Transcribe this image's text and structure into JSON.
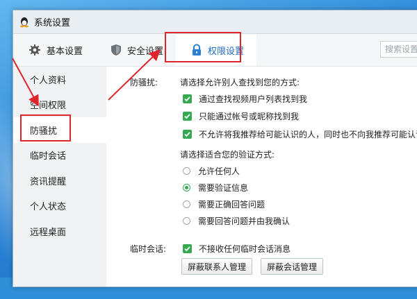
{
  "window": {
    "title": "系统设置"
  },
  "toolbar": {
    "tabs": [
      {
        "label": "基本设置",
        "icon": "gear-icon"
      },
      {
        "label": "安全设置",
        "icon": "shield-icon"
      },
      {
        "label": "权限设置",
        "icon": "lock-icon",
        "active": true
      }
    ],
    "search_placeholder": "搜索设置"
  },
  "sidebar": {
    "items": [
      {
        "label": "个人资料"
      },
      {
        "label": "空间权限"
      },
      {
        "label": "防骚扰",
        "active": true
      },
      {
        "label": "临时会话"
      },
      {
        "label": "资讯提醒"
      },
      {
        "label": "个人状态"
      },
      {
        "label": "远程桌面"
      }
    ]
  },
  "anti_harass": {
    "section_label": "防骚扰:",
    "find_prompt": "请选择允许别人查找到您的方式:",
    "find_options": [
      {
        "label": "通过查找视频用户列表找到我",
        "checked": true
      },
      {
        "label": "只能通过帐号或昵称找到我",
        "checked": true
      },
      {
        "label": "不允许将我推荐给可能认识的人，同时也不向我推荐可能认识",
        "checked": true
      }
    ],
    "verify_prompt": "请选择适合您的验证方式:",
    "verify_options": [
      {
        "label": "允许任何人",
        "selected": false
      },
      {
        "label": "需要验证信息",
        "selected": true
      },
      {
        "label": "需要正确回答问题",
        "selected": false
      },
      {
        "label": "需要回答问题并由我确认",
        "selected": false
      }
    ]
  },
  "temp_session": {
    "section_label": "临时会话:",
    "option_label": "不接收任何临时会话消息",
    "checked": true,
    "buttons": [
      "屏蔽联系人管理",
      "屏蔽会话管理"
    ]
  },
  "colors": {
    "accent": "#1f6dbf",
    "check_green": "#36a852",
    "annotation_red": "#e0242b"
  }
}
